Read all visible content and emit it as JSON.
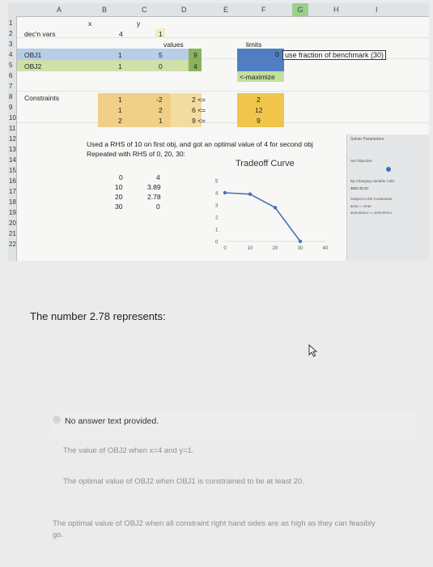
{
  "columns": [
    "A",
    "B",
    "C",
    "D",
    "E",
    "F",
    "G",
    "H",
    "I"
  ],
  "rows": [
    "1",
    "2",
    "3",
    "4",
    "5",
    "6",
    "7",
    "8",
    "9",
    "10",
    "11",
    "12",
    "13",
    "14",
    "15",
    "16",
    "17",
    "18",
    "19",
    "20",
    "21",
    "22"
  ],
  "sheet": {
    "marker_x": "x",
    "marker_y": "y",
    "decn_label": "dec'n vars",
    "decn_x": "4",
    "decn_y": "1",
    "values_label": "values",
    "limits_label": "limits",
    "obj1_label": "OBJ1",
    "obj2_label": "OBJ2",
    "obj1": [
      "1",
      "5",
      "9"
    ],
    "obj2": [
      "1",
      "0",
      "4"
    ],
    "checkbox_value": "0",
    "use_fraction_note": "use fraction of benchmark (30)",
    "maximize_note": "<-maximize",
    "constraints_label": "Constraints",
    "constraints": [
      {
        "x": "1",
        "y": "-2",
        "value": "2",
        "op": "2 <=",
        "rhs": "2"
      },
      {
        "x": "1",
        "y": "2",
        "value": "6",
        "op": "6 <=",
        "rhs": "12"
      },
      {
        "x": "2",
        "y": "1",
        "value": "9",
        "op": "9 <=",
        "rhs": "9"
      }
    ],
    "note_line1": "Used a RHS of 10 on first obj, and got an optimal value of 4 for second obj",
    "note_line2": "Repeated with RHS of 0, 20, 30:",
    "table": [
      [
        "0",
        "4"
      ],
      [
        "10",
        "3.89"
      ],
      [
        "20",
        "2.78"
      ],
      [
        "30",
        "0"
      ]
    ]
  },
  "chart_data": {
    "type": "line",
    "title": "Tradeoff Curve",
    "x": [
      0,
      10,
      20,
      30
    ],
    "series": [
      {
        "values": [
          4,
          3.89,
          2.78,
          0
        ]
      }
    ],
    "xlim": [
      0,
      40
    ],
    "ylim": [
      0,
      5
    ],
    "x_ticks": [
      "0",
      "10",
      "20",
      "30",
      "40"
    ],
    "y_ticks": [
      "0",
      "1",
      "2",
      "3",
      "4",
      "5"
    ],
    "xlabel": "",
    "ylabel": "",
    "grid": false,
    "line_color": "#4a72b8"
  },
  "solver_panel": {
    "title": "Solver Parameters",
    "set_objective": "Set Objective",
    "by_changing": "By Changing Variable Cells",
    "cells": "$B$3:$C$3",
    "subject_to": "Subject to the Constraints",
    "constraint_1": "$D$5 >= $F$5",
    "constraint_2": "$D$9:$D$10 <= $F$9:$F$10"
  },
  "question": {
    "prompt": "The number 2.78 represents:",
    "answer_status": "No answer text provided.",
    "options": [
      "The value of OBJ2 when x=4 and y=1.",
      "The optimal value of OBJ2 when OBJ1 is constrained to be at least 20.",
      "The optimal value of OBJ2 when all constraint right hand sides are as high as they can feasibly go."
    ]
  },
  "colors": {
    "obj_blue": "#b7cde8",
    "obj_green": "#cfe0a8",
    "constraints_orange": "#f0cf86",
    "rhs_orange": "#f0c54c",
    "limits_blue": "#4f7fc2",
    "maximize_green": "#c3df9c"
  }
}
